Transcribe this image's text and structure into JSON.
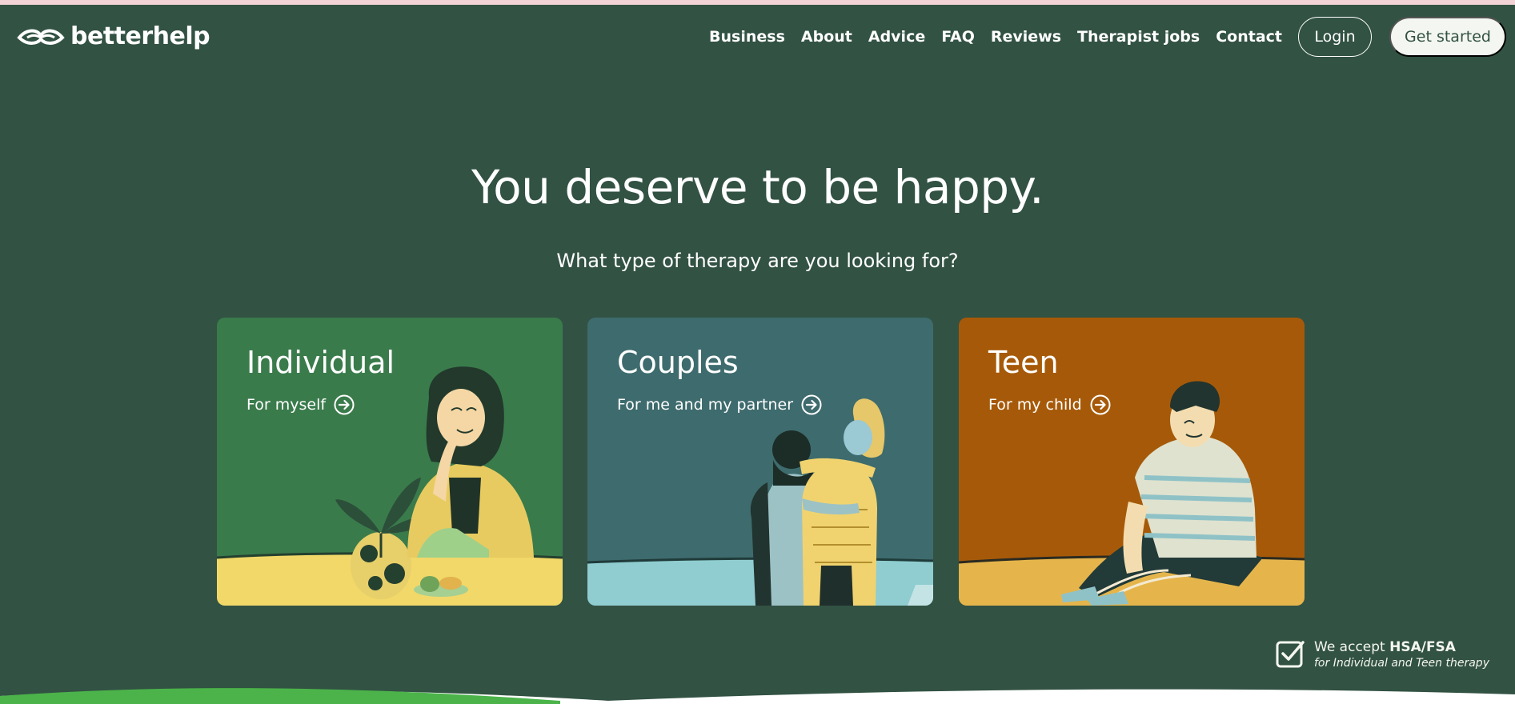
{
  "brand": {
    "name": "betterhelp"
  },
  "nav": {
    "links": [
      "Business",
      "About",
      "Advice",
      "FAQ",
      "Reviews",
      "Therapist jobs",
      "Contact"
    ],
    "login_label": "Login",
    "get_started_label": "Get started"
  },
  "hero": {
    "title": "You deserve to be happy.",
    "subtitle": "What type of therapy are you looking for?"
  },
  "cards": [
    {
      "title": "Individual",
      "subtitle": "For myself"
    },
    {
      "title": "Couples",
      "subtitle": "For me and my partner"
    },
    {
      "title": "Teen",
      "subtitle": "For my child"
    }
  ],
  "hsa": {
    "prefix": "We accept ",
    "highlight": "HSA/FSA",
    "note": "for Individual and Teen therapy"
  },
  "colors": {
    "background": "#325243",
    "individual": "#3a7b4b",
    "couples": "#3e6b6d",
    "teen": "#a65a09",
    "accent_green": "#4bb34a"
  },
  "icons": {
    "logo": "leaf-logo-icon",
    "card_arrow": "arrow-circle-right-icon",
    "hsa_check": "checkbox-icon"
  }
}
